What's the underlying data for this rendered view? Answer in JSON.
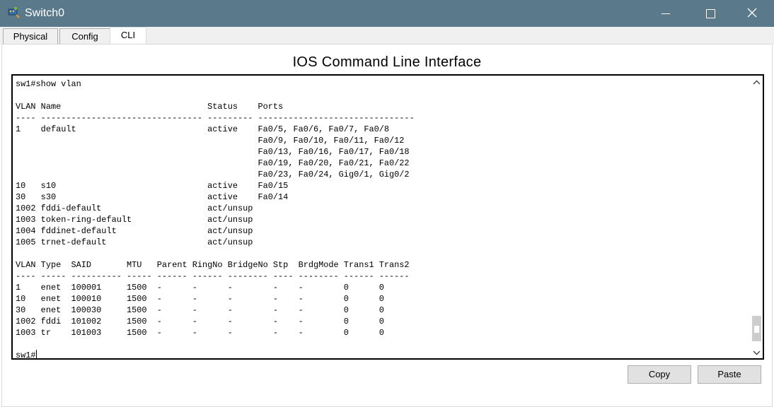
{
  "window": {
    "title": "Switch0",
    "icon": "switch-device-icon",
    "controls": [
      "minimize-icon",
      "maximize-icon",
      "close-icon"
    ]
  },
  "tabs": [
    {
      "label": "Physical",
      "active": false
    },
    {
      "label": "Config",
      "active": false
    },
    {
      "label": "CLI",
      "active": true
    }
  ],
  "main": {
    "heading": "IOS Command Line Interface",
    "console_lines": [
      "sw1#show vlan",
      "",
      "VLAN Name                             Status    Ports",
      "---- -------------------------------- --------- -------------------------------",
      "1    default                          active    Fa0/5, Fa0/6, Fa0/7, Fa0/8",
      "                                                Fa0/9, Fa0/10, Fa0/11, Fa0/12",
      "                                                Fa0/13, Fa0/16, Fa0/17, Fa0/18",
      "                                                Fa0/19, Fa0/20, Fa0/21, Fa0/22",
      "                                                Fa0/23, Fa0/24, Gig0/1, Gig0/2",
      "10   s10                              active    Fa0/15",
      "30   s30                              active    Fa0/14",
      "1002 fddi-default                     act/unsup",
      "1003 token-ring-default               act/unsup",
      "1004 fddinet-default                  act/unsup",
      "1005 trnet-default                    act/unsup",
      "",
      "VLAN Type  SAID       MTU   Parent RingNo BridgeNo Stp  BrdgMode Trans1 Trans2",
      "---- ----- ---------- ----- ------ ------ -------- ---- -------- ------ ------",
      "1    enet  100001     1500  -      -      -        -    -        0      0",
      "10   enet  100010     1500  -      -      -        -    -        0      0",
      "30   enet  100030     1500  -      -      -        -    -        0      0",
      "1002 fddi  101002     1500  -      -      -        -    -        0      0",
      "1003 tr    101003     1500  -      -      -        -    -        0      0",
      "",
      "sw1#"
    ],
    "buttons": {
      "copy": "Copy",
      "paste": "Paste"
    }
  }
}
